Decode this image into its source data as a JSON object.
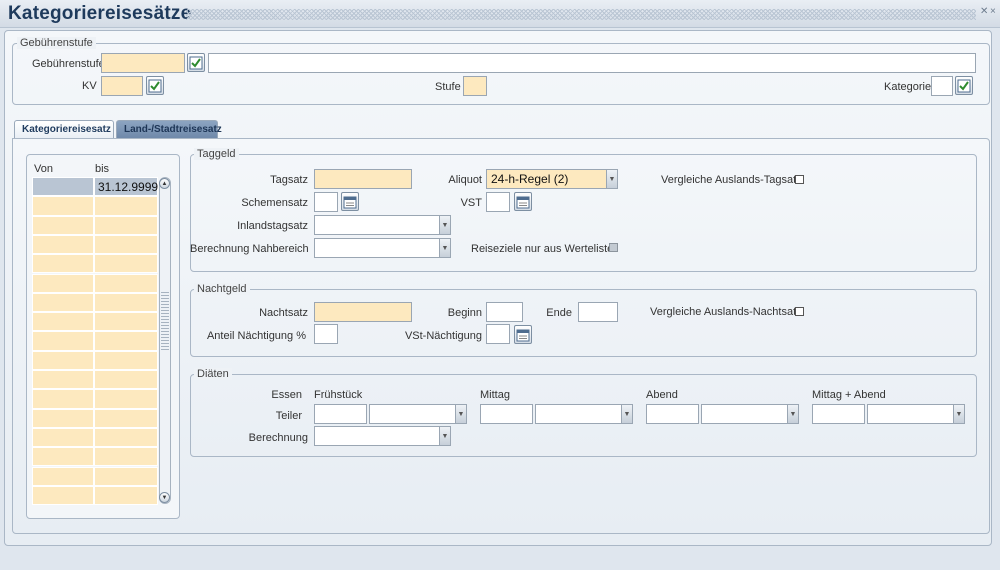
{
  "window": {
    "title": "Kategoriereisesätze",
    "controls": [
      "✕",
      "×"
    ]
  },
  "gebuehrenstufe": {
    "legend": "Gebührenstufe",
    "gebuehrenstufe_label": "Gebührenstufe",
    "gebuehrenstufe_value": "",
    "bezeichnung_value": "",
    "kv_label": "KV",
    "kv_value": "",
    "stufe_label": "Stufe",
    "stufe_value": "",
    "kategorie_label": "Kategorie",
    "kategorie_value": ""
  },
  "tabs": [
    {
      "label": "Kategoriereisesatz",
      "active": true
    },
    {
      "label": "Land-/Stadtreisesatz",
      "active": false
    }
  ],
  "zeitraum": {
    "col_von": "Von",
    "col_bis": "bis",
    "rows": [
      {
        "von": "",
        "bis": "31.12.9999"
      }
    ]
  },
  "taggeld": {
    "legend": "Taggeld",
    "tagsatz_label": "Tagsatz",
    "tagsatz_value": "",
    "schemensatz_label": "Schemensatz",
    "inlandstagsatz_label": "Inlandstagsatz",
    "berechnung_nahbereich_label": "Berechnung Nahbereich",
    "aliquot_label": "Aliquot",
    "aliquot_value": "24-h-Regel (2)",
    "vst_label": "VST",
    "vergleiche_label": "Vergleiche Auslands-Tagsatz",
    "reiseziele_label": "Reiseziele nur aus Werteliste"
  },
  "nachtgeld": {
    "legend": "Nachtgeld",
    "nachtsatz_label": "Nachtsatz",
    "anteil_label": "Anteil Nächtigung %",
    "beginn_label": "Beginn",
    "ende_label": "Ende",
    "vst_naechtigung_label": "VSt-Nächtigung",
    "vergleiche_label": "Vergleiche Auslands-Nachtsatz"
  },
  "diaeten": {
    "legend": "Diäten",
    "essen_label": "Essen",
    "teiler_label": "Teiler",
    "berechnung_label": "Berechnung",
    "meals": [
      "Frühstück",
      "Mittag",
      "Abend",
      "Mittag + Abend"
    ]
  },
  "icons": {
    "lov": "lov-check-icon",
    "calendar": "calendar-icon",
    "dropdown": "dropdown-arrow-icon"
  },
  "colors": {
    "required_field": "#fde9bf",
    "title": "#1e3a5c",
    "selected_row": "#b9c5d3"
  }
}
